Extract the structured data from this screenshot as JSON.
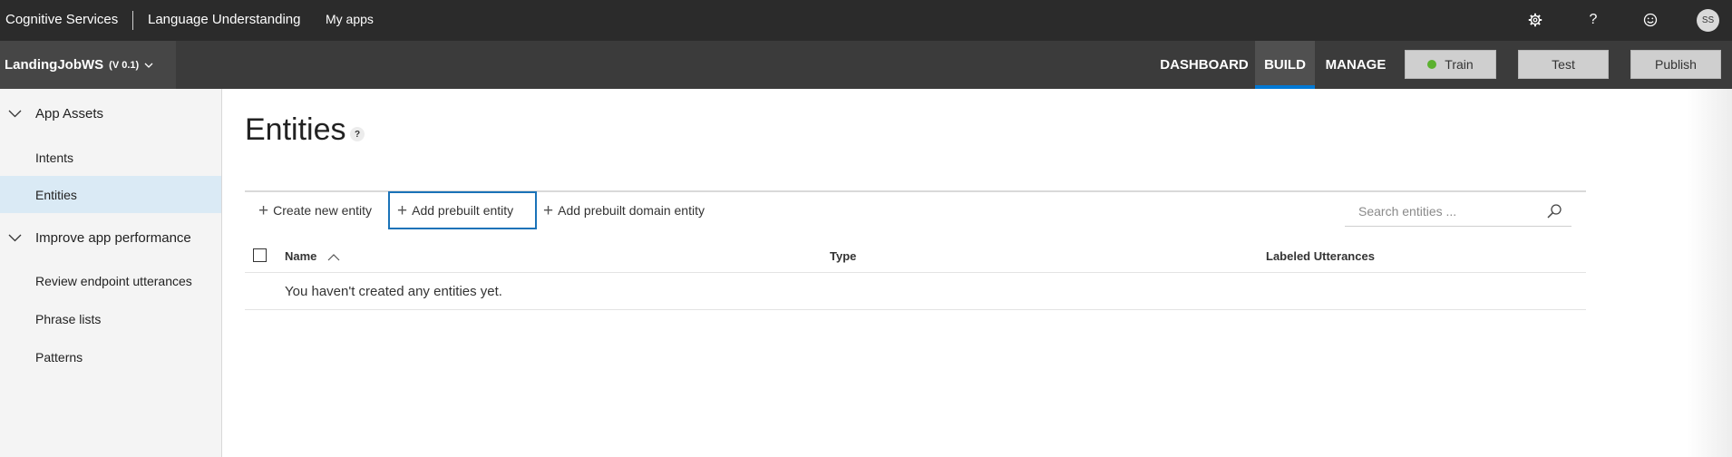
{
  "topbar": {
    "brand": "Cognitive Services",
    "product": "Language Understanding",
    "my_apps": "My apps",
    "icons": [
      "gear-icon",
      "help-icon",
      "smiley-icon"
    ],
    "avatar_initials": "SS"
  },
  "appbar": {
    "app_name": "LandingJobWS",
    "version": "(V 0.1)",
    "nav": [
      {
        "label": "DASHBOARD",
        "active": false
      },
      {
        "label": "BUILD",
        "active": true
      },
      {
        "label": "MANAGE",
        "active": false
      }
    ],
    "buttons": {
      "train": "Train",
      "test": "Test",
      "publish": "Publish"
    },
    "train_status_color": "#5bb12f"
  },
  "sidebar": {
    "groups": [
      {
        "label": "App Assets",
        "items": [
          {
            "label": "Intents",
            "selected": false
          },
          {
            "label": "Entities",
            "selected": true
          }
        ]
      },
      {
        "label": "Improve app performance",
        "items": [
          {
            "label": "Review endpoint utterances",
            "selected": false
          },
          {
            "label": "Phrase lists",
            "selected": false
          },
          {
            "label": "Patterns",
            "selected": false
          }
        ]
      }
    ]
  },
  "main": {
    "title": "Entities",
    "help_badge": "?",
    "commands": {
      "create": "Create new entity",
      "add_prebuilt": "Add prebuilt entity",
      "add_domain": "Add prebuilt domain entity"
    },
    "search": {
      "placeholder": "Search entities ...",
      "value": ""
    },
    "table": {
      "columns": [
        "Name",
        "Type",
        "Labeled Utterances"
      ],
      "sorted_column": "Name",
      "sort_direction": "ascending",
      "empty_message": "You haven't created any entities yet."
    }
  },
  "colors": {
    "topbar": "#2b2b2b",
    "appbar": "#3b3b3b",
    "accent": "#0078d4",
    "selected_item": "#daeaf5"
  }
}
